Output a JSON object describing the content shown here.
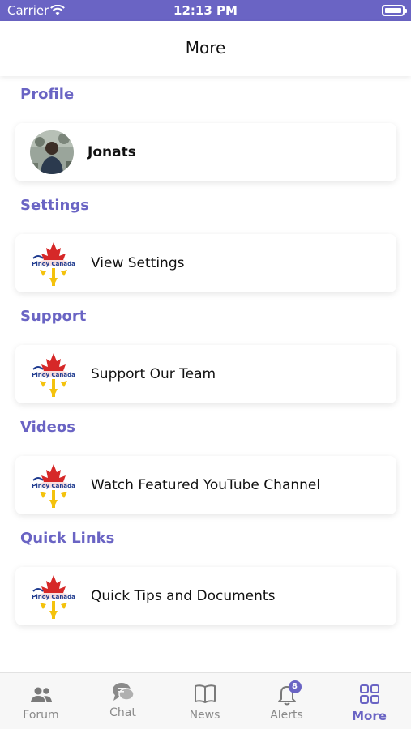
{
  "status_bar": {
    "carrier": "Carrier",
    "time": "12:13 PM"
  },
  "header": {
    "title": "More"
  },
  "sections": {
    "profile": {
      "title": "Profile",
      "item_label": "Jonats"
    },
    "settings": {
      "title": "Settings",
      "item_label": "View Settings"
    },
    "support": {
      "title": "Support",
      "item_label": "Support Our Team"
    },
    "videos": {
      "title": "Videos",
      "item_label": "Watch Featured YouTube Channel"
    },
    "quick_links": {
      "title": "Quick Links",
      "item_label": "Quick Tips and Documents"
    }
  },
  "logo_text": "Pinoy Canada",
  "tab_bar": {
    "forum": "Forum",
    "chat": "Chat",
    "news": "News",
    "alerts": "Alerts",
    "alerts_badge": "8",
    "more": "More"
  },
  "colors": {
    "accent": "#6a64c4",
    "maple_red": "#d62828",
    "sun_yellow": "#f4c20d"
  },
  "icons": {
    "forum": "people-icon",
    "chat": "chat-bubbles-icon",
    "news": "book-icon",
    "alerts": "bell-icon",
    "more": "grid-icon"
  }
}
